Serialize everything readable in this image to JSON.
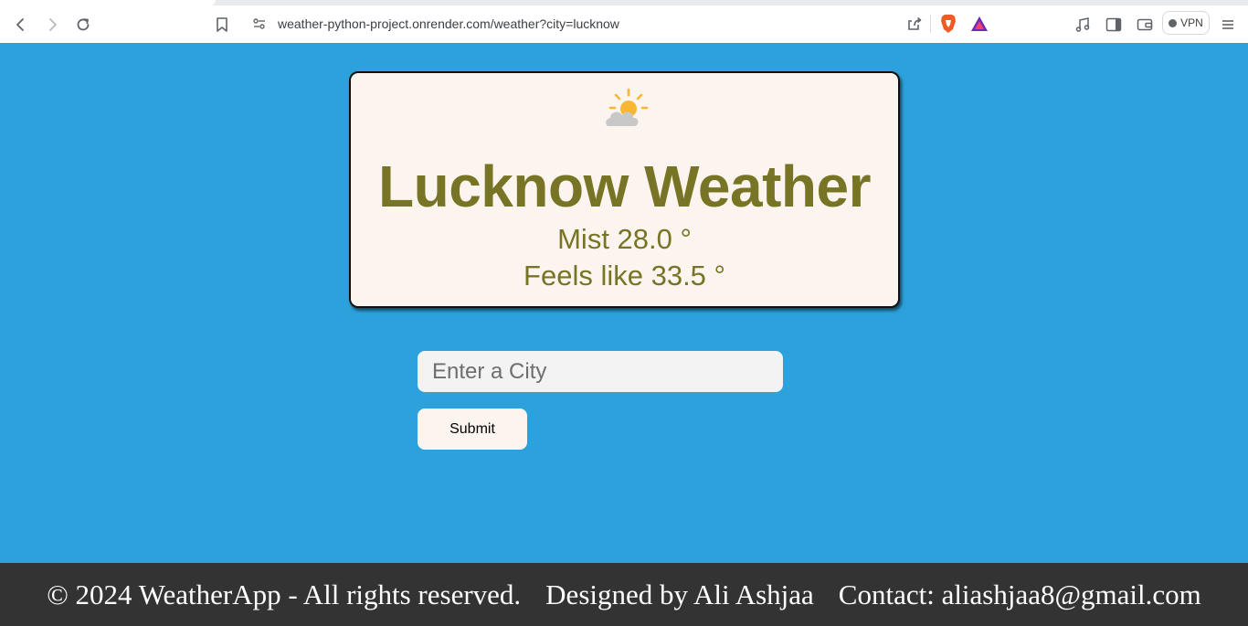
{
  "browser": {
    "url": "weather-python-project.onrender.com/weather?city=lucknow",
    "vpn_label": "VPN",
    "icons": {
      "back": "back-arrow-icon",
      "forward": "forward-arrow-icon",
      "reload": "reload-icon",
      "bookmark": "bookmark-icon",
      "site_settings": "site-settings-icon",
      "share": "share-icon",
      "brave_shields": "brave-shields-icon",
      "brave_rewards": "brave-rewards-icon",
      "media": "music-note-icon",
      "sidebar": "sidebar-icon",
      "wallet": "wallet-icon",
      "menu": "hamburger-menu-icon"
    }
  },
  "weather": {
    "icon": "sun-behind-cloud-icon",
    "title": "Lucknow Weather",
    "condition_line": "Mist 28.0 °",
    "feels_like_line": "Feels like 33.5 °"
  },
  "form": {
    "city_placeholder": "Enter a City",
    "city_value": "",
    "submit_label": "Submit"
  },
  "footer": {
    "copyright": "© 2024 WeatherApp - All rights reserved.",
    "designer": "Designed by Ali Ashjaa",
    "contact": "Contact: aliashjaa8@gmail.com"
  },
  "colors": {
    "page_background": "#2ca1db",
    "card_background": "#fcf5ef",
    "title_text": "#777425",
    "footer_background": "#333333",
    "footer_text": "#ffffff",
    "input_background": "#f3f3f3"
  }
}
